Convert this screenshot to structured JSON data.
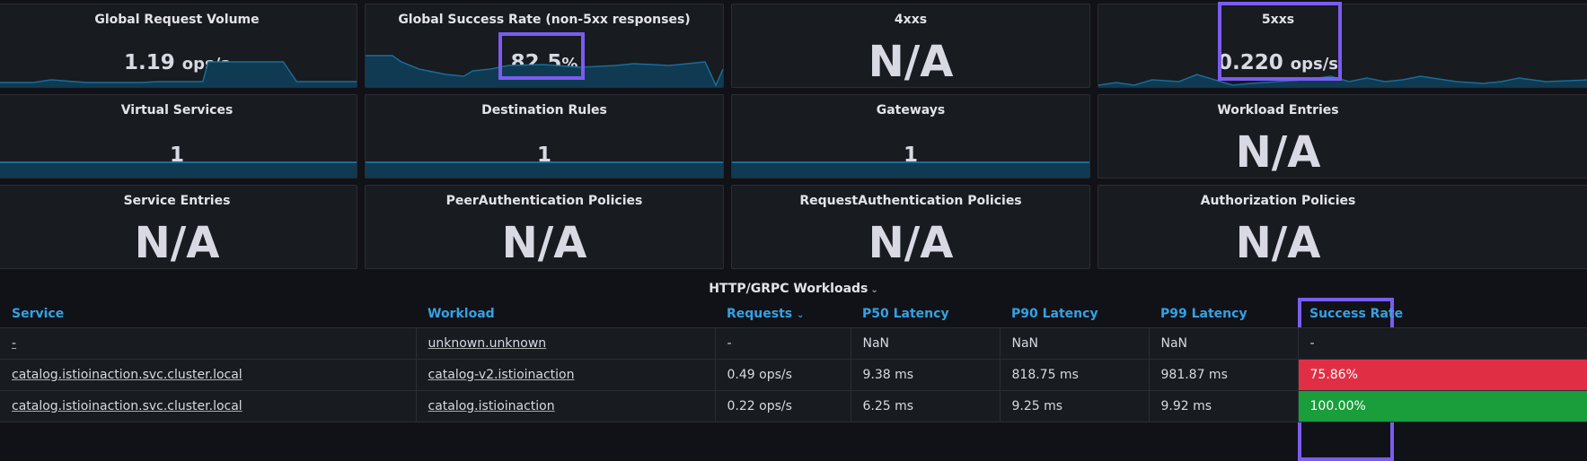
{
  "panels": {
    "request_volume": {
      "title": "Global Request Volume",
      "value": "1.19",
      "unit": "ops/s"
    },
    "success_rate": {
      "title": "Global Success Rate (non-5xx responses)",
      "value": "82.5",
      "unit": "%"
    },
    "fourxx": {
      "title": "4xxs",
      "value": "N/A"
    },
    "fivexx": {
      "title": "5xxs",
      "value": "0.220",
      "unit": "ops/s"
    },
    "virtual_services": {
      "title": "Virtual Services",
      "value": "1"
    },
    "destination_rules": {
      "title": "Destination Rules",
      "value": "1"
    },
    "gateways": {
      "title": "Gateways",
      "value": "1"
    },
    "workload_entries": {
      "title": "Workload Entries",
      "value": "N/A"
    },
    "service_entries": {
      "title": "Service Entries",
      "value": "N/A"
    },
    "peer_auth": {
      "title": "PeerAuthentication Policies",
      "value": "N/A"
    },
    "request_auth": {
      "title": "RequestAuthentication Policies",
      "value": "N/A"
    },
    "authz": {
      "title": "Authorization Policies",
      "value": "N/A"
    }
  },
  "workloads": {
    "title": "HTTP/GRPC Workloads",
    "columns": [
      "Service",
      "Workload",
      "Requests",
      "P50 Latency",
      "P90 Latency",
      "P99 Latency",
      "Success Rate"
    ],
    "rows": [
      {
        "service": "-",
        "workload": "unknown.unknown",
        "requests": "-",
        "p50": "NaN",
        "p90": "NaN",
        "p99": "NaN",
        "success": "-"
      },
      {
        "service": "catalog.istioinaction.svc.cluster.local",
        "workload": "catalog-v2.istioinaction",
        "requests": "0.49 ops/s",
        "p50": "9.38 ms",
        "p90": "818.75 ms",
        "p99": "981.87 ms",
        "success": "75.86%"
      },
      {
        "service": "catalog.istioinaction.svc.cluster.local",
        "workload": "catalog.istioinaction",
        "requests": "0.22 ops/s",
        "p50": "6.25 ms",
        "p90": "9.25 ms",
        "p99": "9.92 ms",
        "success": "100.00%"
      }
    ]
  },
  "colors": {
    "accent": "#33a2e5",
    "highlight": "#7b5cf0",
    "bad": "#e02f44",
    "good": "#1a9e3b"
  }
}
